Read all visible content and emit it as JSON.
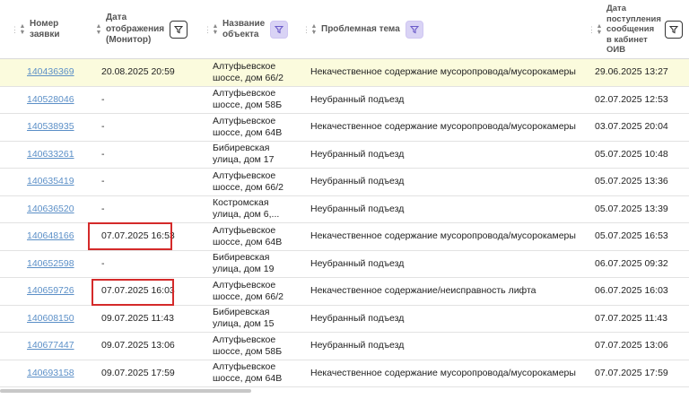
{
  "columns": {
    "id": [
      "Номер",
      "заявки"
    ],
    "display_date": [
      "Дата",
      "отображения",
      "(Монитор)"
    ],
    "object": [
      "Название",
      "объекта"
    ],
    "topic": [
      "Проблемная тема"
    ],
    "received": [
      "Дата",
      "поступления",
      "сообщения",
      "в кабинет",
      "ОИВ"
    ]
  },
  "icons": {
    "drag": "drag-handle-icon",
    "sort": "sort-arrows-icon",
    "filter": "filter-funnel-icon"
  },
  "colors": {
    "link": "#5b8fc7",
    "highlight_row": "#fbfbdd",
    "filter_active": "#d9d3f5",
    "annotation_box": "#d42a2a"
  },
  "rows": [
    {
      "id": "140436369",
      "display_date": "20.08.2025 20:59",
      "object": [
        "Алтуфьевское",
        "шоссе, дом 66/2"
      ],
      "topic": "Некачественное содержание мусоропровода/мусорокамеры",
      "received": "29.06.2025 13:27"
    },
    {
      "id": "140528046",
      "display_date": "-",
      "object": [
        "Алтуфьевское",
        "шоссе, дом 58Б"
      ],
      "topic": "Неубранный подъезд",
      "received": "02.07.2025 12:53"
    },
    {
      "id": "140538935",
      "display_date": "-",
      "object": [
        "Алтуфьевское",
        "шоссе, дом 64В"
      ],
      "topic": "Некачественное содержание мусоропровода/мусорокамеры",
      "received": "03.07.2025 20:04"
    },
    {
      "id": "140633261",
      "display_date": "-",
      "object": [
        "Бибиревская",
        "улица, дом 17"
      ],
      "topic": "Неубранный подъезд",
      "received": "05.07.2025 10:48"
    },
    {
      "id": "140635419",
      "display_date": "-",
      "object": [
        "Алтуфьевское",
        "шоссе, дом 66/2"
      ],
      "topic": "Неубранный подъезд",
      "received": "05.07.2025 13:36"
    },
    {
      "id": "140636520",
      "display_date": "-",
      "object": [
        "Костромская",
        "улица, дом 6,..."
      ],
      "topic": "Неубранный подъезд",
      "received": "05.07.2025 13:39"
    },
    {
      "id": "140648166",
      "display_date": "07.07.2025 16:53",
      "object": [
        "Алтуфьевское",
        "шоссе, дом 64В"
      ],
      "topic": "Некачественное содержание мусоропровода/мусорокамеры",
      "received": "05.07.2025 16:53"
    },
    {
      "id": "140652598",
      "display_date": "-",
      "object": [
        "Бибиревская",
        "улица, дом 19"
      ],
      "topic": "Неубранный подъезд",
      "received": "06.07.2025 09:32"
    },
    {
      "id": "140659726",
      "display_date": "07.07.2025 16:03",
      "object": [
        "Алтуфьевское",
        "шоссе, дом 66/2"
      ],
      "topic": "Некачественное содержание/неисправность лифта",
      "received": "06.07.2025 16:03"
    },
    {
      "id": "140608150",
      "display_date": "09.07.2025 11:43",
      "object": [
        "Бибиревская",
        "улица, дом 15"
      ],
      "topic": "Неубранный подъезд",
      "received": "07.07.2025 11:43"
    },
    {
      "id": "140677447",
      "display_date": "09.07.2025 13:06",
      "object": [
        "Алтуфьевское",
        "шоссе, дом 58Б"
      ],
      "topic": "Неубранный подъезд",
      "received": "07.07.2025 13:06"
    },
    {
      "id": "140693158",
      "display_date": "09.07.2025 17:59",
      "object": [
        "Алтуфьевское",
        "шоссе, дом 64В"
      ],
      "topic": "Некачественное содержание мусоропровода/мусорокамеры",
      "received": "07.07.2025 17:59"
    }
  ]
}
